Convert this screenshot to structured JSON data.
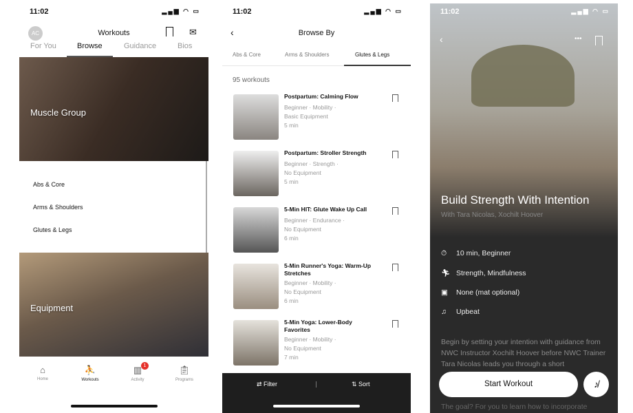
{
  "status": {
    "time": "11:02"
  },
  "panel1": {
    "avatar": "AC",
    "title": "Workouts",
    "tabs": [
      "For You",
      "Browse",
      "Guidance",
      "Bios"
    ],
    "active_tab": "Browse",
    "sections": [
      {
        "label": "Muscle Group",
        "items": [
          "Abs & Core",
          "Arms & Shoulders",
          "Glutes & Legs"
        ]
      },
      {
        "label": "Equipment"
      }
    ],
    "tabbar": [
      {
        "label": "Home"
      },
      {
        "label": "Workouts",
        "active": true
      },
      {
        "label": "Activity",
        "badge": "1"
      },
      {
        "label": "Programs"
      }
    ],
    "badge_color": "#e5322b"
  },
  "panel2": {
    "title": "Browse By",
    "tabs": [
      "Abs & Core",
      "Arms & Shoulders",
      "Glutes & Legs"
    ],
    "active_tab": "Glutes & Legs",
    "count": "95 workouts",
    "workouts": [
      {
        "title": "Postpartum: Calming Flow",
        "meta1": "Beginner · Mobility ·",
        "meta2": "Basic Equipment",
        "duration": "5 min"
      },
      {
        "title": "Postpartum: Stroller Strength",
        "meta1": "Beginner · Strength ·",
        "meta2": "No Equipment",
        "duration": "5 min"
      },
      {
        "title": "5-Min HIT: Glute Wake Up Call",
        "meta1": "Beginner · Endurance ·",
        "meta2": "No Equipment",
        "duration": "6 min"
      },
      {
        "title": "5-Min Runner's Yoga: Warm-Up Stretches",
        "meta1": "Beginner · Mobility ·",
        "meta2": "No Equipment",
        "duration": "6 min"
      },
      {
        "title": "5-Min Yoga: Lower-Body Favorites",
        "meta1": "Beginner · Mobility ·",
        "meta2": "No Equipment",
        "duration": "7 min"
      }
    ],
    "filter": "Filter",
    "sort": "Sort"
  },
  "panel3": {
    "title": "Build Strength With Intention",
    "subtitle": "With Tara Nicolas, Xochilt Hoover",
    "info": [
      {
        "icon": "stopwatch-icon",
        "text": "10 min, Beginner"
      },
      {
        "icon": "figure-icon",
        "text": "Strength, Mindfulness"
      },
      {
        "icon": "kettlebell-icon",
        "text": "None (mat optional)"
      },
      {
        "icon": "music-icon",
        "text": "Upbeat"
      }
    ],
    "description": "Begin by setting your intention with guidance from NWC Instructor Xochilt Hoover before NWC Trainer Tara Nicolas leads you through a short",
    "description2": "The goal? For you to learn how to incorporate",
    "start": "Start Workout"
  }
}
